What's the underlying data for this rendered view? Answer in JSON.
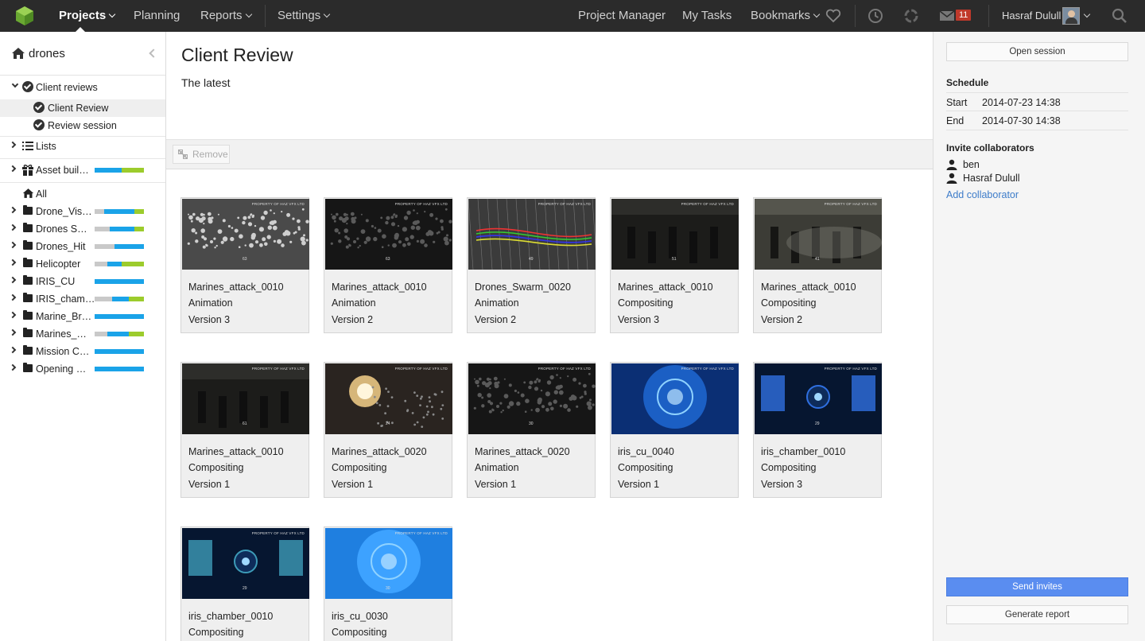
{
  "topbar": {
    "nav": [
      {
        "label": "Projects",
        "caret": true,
        "active": true
      },
      {
        "label": "Planning",
        "caret": false
      },
      {
        "label": "Reports",
        "caret": true
      },
      {
        "label": "Settings",
        "caret": true
      }
    ],
    "right_nav": [
      {
        "label": "Project Manager"
      },
      {
        "label": "My Tasks"
      },
      {
        "label": "Bookmarks",
        "caret": true
      }
    ],
    "icons": [
      "heart-icon",
      "clock-icon",
      "spinner-icon",
      "mail-icon",
      "search-icon"
    ],
    "inbox_count": "11",
    "user_name": "Hasraf Dulull",
    "colors": {
      "bar": "#2b2b2b",
      "badge": "#c0392b",
      "logo": "#7fbf3f"
    }
  },
  "sidebar": {
    "project": "drones",
    "client_reviews": {
      "label": "Client reviews",
      "children": [
        {
          "label": "Client Review",
          "selected": true
        },
        {
          "label": "Review session",
          "selected": false
        }
      ]
    },
    "lists_label": "Lists",
    "asset_builds": {
      "label": "Asset buil…",
      "progress": {
        "done": 0,
        "progress": 0.55,
        "approved": 0.45
      }
    },
    "all_label": "All",
    "folders": [
      {
        "label": "Drone_Vis…",
        "progress": {
          "done": 0.2,
          "progress": 0.6,
          "approved": 0.2
        }
      },
      {
        "label": "Drones S…",
        "progress": {
          "done": 0.3,
          "progress": 0.5,
          "approved": 0.2
        }
      },
      {
        "label": "Drones_Hit",
        "progress": {
          "done": 0.4,
          "progress": 0.6,
          "approved": 0
        }
      },
      {
        "label": "Helicopter",
        "progress": {
          "done": 0.25,
          "progress": 0.3,
          "approved": 0.45
        }
      },
      {
        "label": "IRIS_CU",
        "progress": {
          "done": 0,
          "progress": 1,
          "approved": 0
        }
      },
      {
        "label": "IRIS_cham…",
        "progress": {
          "done": 0.35,
          "progress": 0.35,
          "approved": 0.3
        }
      },
      {
        "label": "Marine_Br…",
        "progress": {
          "done": 0,
          "progress": 1,
          "approved": 0
        }
      },
      {
        "label": "Marines_…",
        "progress": {
          "done": 0.25,
          "progress": 0.45,
          "approved": 0.3
        }
      },
      {
        "label": "Mission C…",
        "progress": {
          "done": 0,
          "progress": 1,
          "approved": 0
        }
      },
      {
        "label": "Opening …",
        "progress": {
          "done": 0,
          "progress": 1,
          "approved": 0
        }
      }
    ],
    "progress_colors": {
      "done": "#c9c9c9",
      "progress": "#1aa3e8",
      "approved": "#9ccc2c"
    }
  },
  "main": {
    "title": "Client Review",
    "description": "The latest",
    "remove_label": "Remove",
    "watermark": "PROPERTY OF HAZ VFX LTD",
    "items": [
      {
        "name": "Marines_attack_0010",
        "task": "Animation",
        "version": "Version 3",
        "frame": "63",
        "style": "grey-particles"
      },
      {
        "name": "Marines_attack_0010",
        "task": "Animation",
        "version": "Version 2",
        "frame": "63",
        "style": "dark-particles"
      },
      {
        "name": "Drones_Swarm_0020",
        "task": "Animation",
        "version": "Version 2",
        "frame": "49",
        "style": "wire-lines"
      },
      {
        "name": "Marines_attack_0010",
        "task": "Compositing",
        "version": "Version 3",
        "frame": "51",
        "style": "dark-room"
      },
      {
        "name": "Marines_attack_0010",
        "task": "Compositing",
        "version": "Version 2",
        "frame": "41",
        "style": "smoke-room"
      },
      {
        "name": "Marines_attack_0010",
        "task": "Compositing",
        "version": "Version 1",
        "frame": "61",
        "style": "dark-room"
      },
      {
        "name": "Marines_attack_0020",
        "task": "Compositing",
        "version": "Version 1",
        "frame": "24",
        "style": "explosion"
      },
      {
        "name": "Marines_attack_0020",
        "task": "Animation",
        "version": "Version 1",
        "frame": "30",
        "style": "dark-particles"
      },
      {
        "name": "iris_cu_0040",
        "task": "Compositing",
        "version": "Version 1",
        "frame": "",
        "style": "blue-iris"
      },
      {
        "name": "iris_chamber_0010",
        "task": "Compositing",
        "version": "Version 3",
        "frame": "29",
        "style": "blue-chamber"
      },
      {
        "name": "iris_chamber_0010",
        "task": "Compositing",
        "version": "",
        "frame": "29",
        "style": "teal-chamber"
      },
      {
        "name": "iris_cu_0030",
        "task": "Compositing",
        "version": "",
        "frame": "30",
        "style": "bright-iris"
      }
    ]
  },
  "panel": {
    "open_session": "Open session",
    "schedule_label": "Schedule",
    "start_label": "Start",
    "start_value": "2014-07-23 14:38",
    "end_label": "End",
    "end_value": "2014-07-30 14:38",
    "invite_label": "Invite collaborators",
    "collaborators": [
      "ben",
      "Hasraf Dulull"
    ],
    "add_collaborator": "Add collaborator",
    "send_invites": "Send invites",
    "generate_report": "Generate report",
    "accent": "#5a8df0"
  }
}
